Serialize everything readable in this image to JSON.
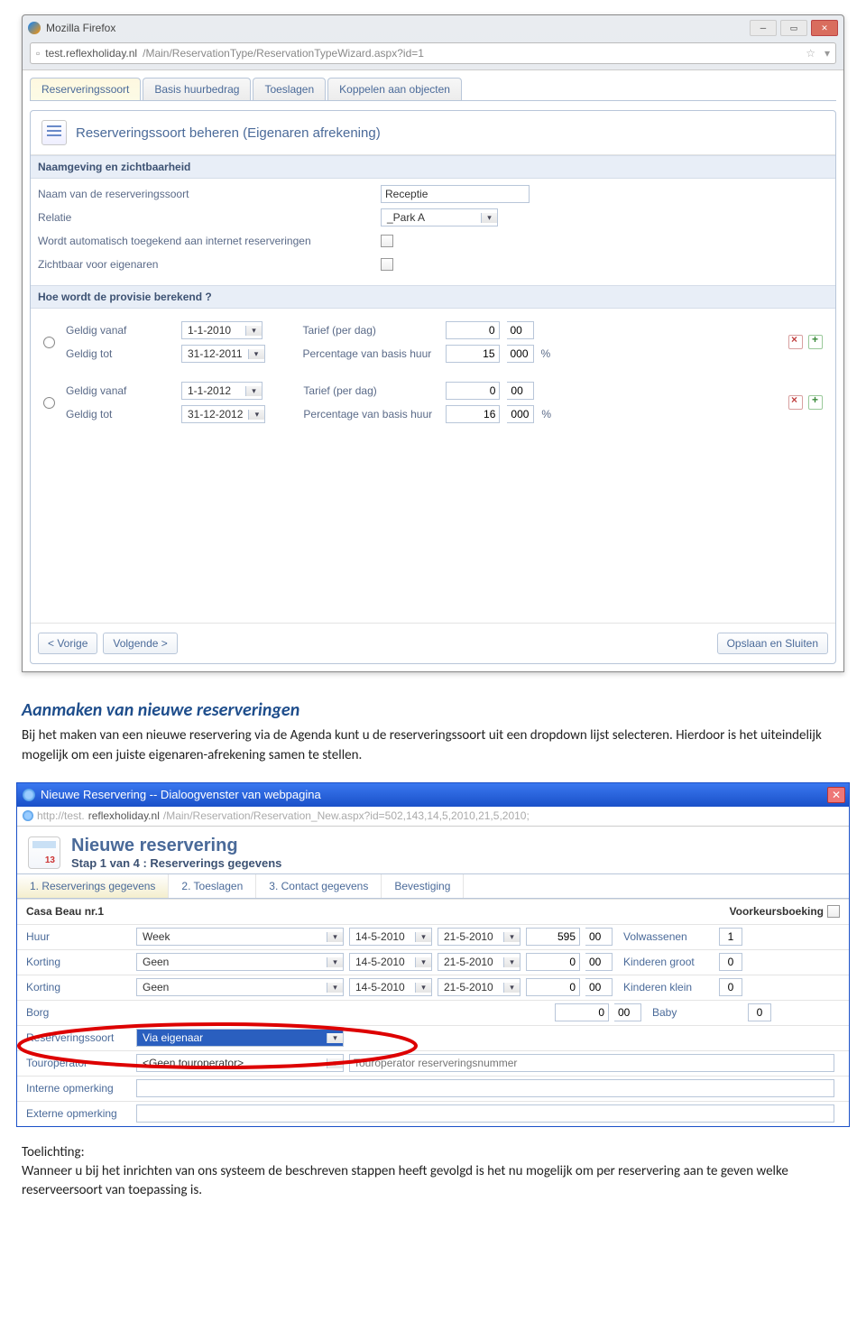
{
  "ff": {
    "appTitle": "Mozilla Firefox",
    "url_host": "test.reflexholiday.nl",
    "url_path": "/Main/ReservationType/ReservationTypeWizard.aspx?id=1"
  },
  "wizard": {
    "tabs": [
      "Reserveringssoort",
      "Basis huurbedrag",
      "Toeslagen",
      "Koppelen aan objecten"
    ],
    "title": "Reserveringssoort beheren (Eigenaren afrekening)",
    "section1": {
      "head": "Naamgeving en zichtbaarheid",
      "rows": {
        "name_label": "Naam van de reserveringssoort",
        "name_value": "Receptie",
        "relation_label": "Relatie",
        "relation_value": "_Park A",
        "auto_label": "Wordt automatisch toegekend aan internet reserveringen",
        "visible_label": "Zichtbaar voor eigenaren"
      }
    },
    "section2": {
      "head": "Hoe wordt de provisie berekend ?",
      "labels": {
        "geldig_vanaf": "Geldig vanaf",
        "geldig_tot": "Geldig tot",
        "tarief": "Tarief (per dag)",
        "percentage": "Percentage van basis huur",
        "pct_suffix": "%"
      },
      "rows": [
        {
          "vanaf": "1-1-2010",
          "tot": "31-12-2011",
          "tarief": "0",
          "tarief_c": "00",
          "pct": "15",
          "pct_c": "000"
        },
        {
          "vanaf": "1-1-2012",
          "tot": "31-12-2012",
          "tarief": "0",
          "tarief_c": "00",
          "pct": "16",
          "pct_c": "000"
        }
      ]
    },
    "footer": {
      "prev": "< Vorige",
      "next": "Volgende >",
      "save": "Opslaan en Sluiten"
    }
  },
  "doc": {
    "heading": "Aanmaken van nieuwe reserveringen",
    "body": "Bij het maken van een nieuwe reservering via de Agenda kunt u de reserveringssoort uit een dropdown lijst selecteren. Hierdoor is het uiteindelijk mogelijk om een juiste eigenaren-afrekening samen te stellen.",
    "caption_lead": "Toelichting:",
    "caption_body": "Wanneer u bij het inrichten van ons systeem de beschreven stappen heeft gevolgd is het nu mogelijk om per reservering aan te geven welke reserveersoort van toepassing is."
  },
  "ie": {
    "title": "Nieuwe Reservering -- Dialoogvenster van webpagina",
    "url_prefix": "http://test.",
    "url_host": "reflexholiday.nl",
    "url_path": "/Main/Reservation/Reservation_New.aspx?id=502,143,14,5,2010,21,5,2010;",
    "dlg_title": "Nieuwe reservering",
    "dlg_sub": "Stap 1 van 4 : Reserverings gegevens",
    "tabs": [
      "1. Reserverings gegevens",
      "2. Toeslagen",
      "3. Contact gegevens",
      "Bevestiging"
    ],
    "object": "Casa Beau nr.1",
    "voorkeur": "Voorkeursboeking",
    "labels": {
      "huur": "Huur",
      "korting": "Korting",
      "borg": "Borg",
      "reserveringssoort": "Reserveringssoort",
      "touroperator": "Touroperator",
      "tournr": "Touroperator reserveringsnummer",
      "interne": "Interne opmerking",
      "externe": "Externe opmerking",
      "volw": "Volwassenen",
      "kg": "Kinderen groot",
      "kk": "Kinderen klein",
      "baby": "Baby"
    },
    "rows": {
      "huur": {
        "combo": "Week",
        "d1": "14-5-2010",
        "d2": "21-5-2010",
        "amt": "595",
        "amtc": "00",
        "people": "1"
      },
      "korting1": {
        "combo": "Geen",
        "d1": "14-5-2010",
        "d2": "21-5-2010",
        "amt": "0",
        "amtc": "00",
        "people": "0"
      },
      "korting2": {
        "combo": "Geen",
        "d1": "14-5-2010",
        "d2": "21-5-2010",
        "amt": "0",
        "amtc": "00",
        "people": "0"
      },
      "borg": {
        "amt": "0",
        "amtc": "00",
        "people": "0"
      },
      "ressoort": "Via eigenaar",
      "tourop": "<Geen touroperator>"
    }
  }
}
